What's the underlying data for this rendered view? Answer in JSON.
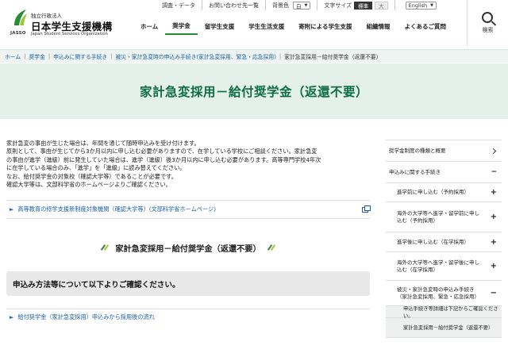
{
  "header": {
    "logo_jasso": "JASSO",
    "logo_org": "独立行政法人",
    "logo_name": "日本学生支援機構",
    "logo_en": "Japan Student Services Organization",
    "utility": {
      "survey": "調査・データ",
      "contact": "お問い合わせ先一覧",
      "bg_label": "背景色",
      "bg_value": "白",
      "size_label": "文字サイズ",
      "size_standard": "標準",
      "size_large": "大",
      "language": "English"
    },
    "search_label": "検索",
    "nav": [
      "ホーム",
      "奨学金",
      "留学生支援",
      "学生生活支援",
      "寄附による学生支援",
      "組織情報",
      "よくあるご質問"
    ]
  },
  "breadcrumb": [
    "ホーム",
    "奨学金",
    "申込みに関する手続き",
    "被災・家計急変時の申込み手続き(家計急変採用、緊急・応急採用)",
    "家計急変採用－給付奨学金（返還不要）"
  ],
  "page_title": "家計急変採用－給付奨学金（返還不要）",
  "intro": [
    "家計急変の事由が生じた場合は、年間を通じて随時申込みを受け付けます。",
    "原則として、事由が生じてから3か月以内に申し込む必要がありますので、在学している学校にご相談ください。家計急変",
    "の事由が進学（進級）前に発生していた場合は、進学（進級）後3か月以内に申し込む必要があります。高等専門学校4年次",
    "に在学している場合のみ、「進学」を「進級」に読み替えてください。",
    "なお、給付奨学金の対象校（確認大学等）であることが必要です。",
    "確認大学等は、文部科学省のホームページよりご確認ください。"
  ],
  "ext_link": "高等教育の修学支援新制度対象機関（確認大学等）(文部科学省ホームページ)",
  "section_title": "家計急変採用－給付奨学金（返還不要）",
  "notice": "申込み方法等について以下よりご確認ください。",
  "sub_link": "給付奨学金（家計急変採用）申込みから採用後の流れ",
  "sidebar": {
    "top1": "奨学金制度の種類と概要",
    "top2": "申込みに関する手続き",
    "items": [
      "進学前に申し込む（予約採用）",
      "海外の大学等へ進学・留学前に申し込む（予約採用）",
      "進学後に申し込む（在学採用）",
      "海外の大学等へ進学・留学後に申し込む（在学採用）",
      "被災・家計急変時の申込み手続き（家計急変採用、緊急・応急採用）"
    ],
    "subs": [
      "申込手続き等詳細は下記からご確認ください。",
      "家計急変採用－給付奨学金（返還不要）"
    ]
  },
  "colors": {
    "brand_green": "#0f6d43",
    "banner_bg": "#e3f1ea",
    "link_blue": "#1a5fa8"
  }
}
